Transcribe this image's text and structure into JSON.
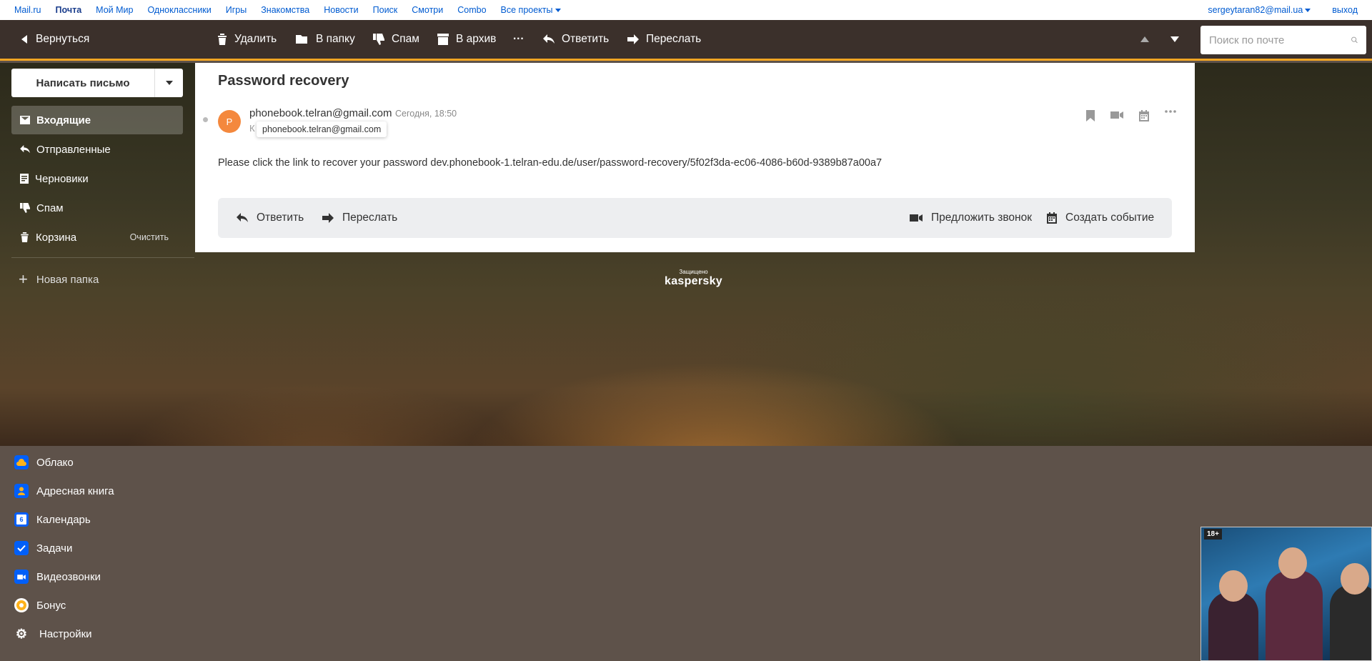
{
  "portal": {
    "links": [
      "Mail.ru",
      "Почта",
      "Мой Мир",
      "Одноклассники",
      "Игры",
      "Знакомства",
      "Новости",
      "Поиск",
      "Смотри",
      "Combo",
      "Все проекты"
    ],
    "user_email": "sergeytaran82@mail.ua",
    "logout": "выход"
  },
  "toolbar": {
    "back": "Вернуться",
    "delete": "Удалить",
    "to_folder": "В папку",
    "spam": "Спам",
    "archive": "В архив",
    "more": "···",
    "reply": "Ответить",
    "forward": "Переслать",
    "search_placeholder": "Поиск по почте"
  },
  "sidebar": {
    "compose": "Написать письмо",
    "folders": [
      {
        "label": "Входящие"
      },
      {
        "label": "Отправленные"
      },
      {
        "label": "Черновики"
      },
      {
        "label": "Спам"
      },
      {
        "label": "Корзина",
        "action": "Очистить"
      }
    ],
    "new_folder": "Новая папка"
  },
  "message": {
    "subject": "Password recovery",
    "avatar_letter": "P",
    "from": "phonebook.telran@gmail.com",
    "date": "Сегодня, 18:50",
    "to_prefix": "К",
    "tooltip": "phonebook.telran@gmail.com",
    "body": "Please click the link to recover your password dev.phonebook-1.telran-edu.de/user/password-recovery/5f02f3da-ec06-4086-b60d-9389b87a00a7",
    "actions": {
      "reply": "Ответить",
      "forward": "Переслать",
      "call": "Предложить звонок",
      "event": "Создать событие"
    }
  },
  "protection": {
    "small": "Защищено",
    "brand": "kaspersky"
  },
  "apps": [
    {
      "label": "Облако"
    },
    {
      "label": "Адресная книга"
    },
    {
      "label": "Календарь",
      "icon_text": "6"
    },
    {
      "label": "Задачи"
    },
    {
      "label": "Видеозвонки"
    },
    {
      "label": "Бонус"
    },
    {
      "label": "Настройки"
    }
  ],
  "ad": {
    "age": "18+"
  },
  "colors": {
    "accent": "#f5a623",
    "toolbar": "#3b302b",
    "link": "#005bd1",
    "avatar": "#f4883d",
    "app_icon": "#005ff9"
  }
}
